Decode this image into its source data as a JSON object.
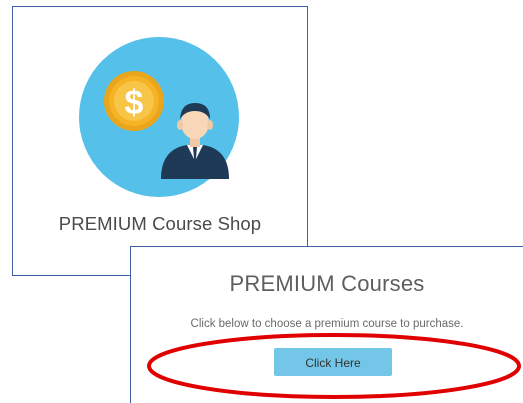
{
  "shop_card": {
    "title": "PREMIUM Course Shop",
    "icon": "money-person-icon"
  },
  "courses_card": {
    "title": "PREMIUM Courses",
    "description": "Click below to choose a premium course to purchase.",
    "button_label": "Click Here"
  },
  "annotation": {
    "type": "highlight-ellipse",
    "color": "#e00000"
  },
  "colors": {
    "card_border": "#3d5fa6",
    "icon_circle": "#55c0ea",
    "coin": "#f5b325",
    "coin_inner": "#f7c548",
    "suit": "#1f3a57",
    "button": "#74c6e8"
  }
}
